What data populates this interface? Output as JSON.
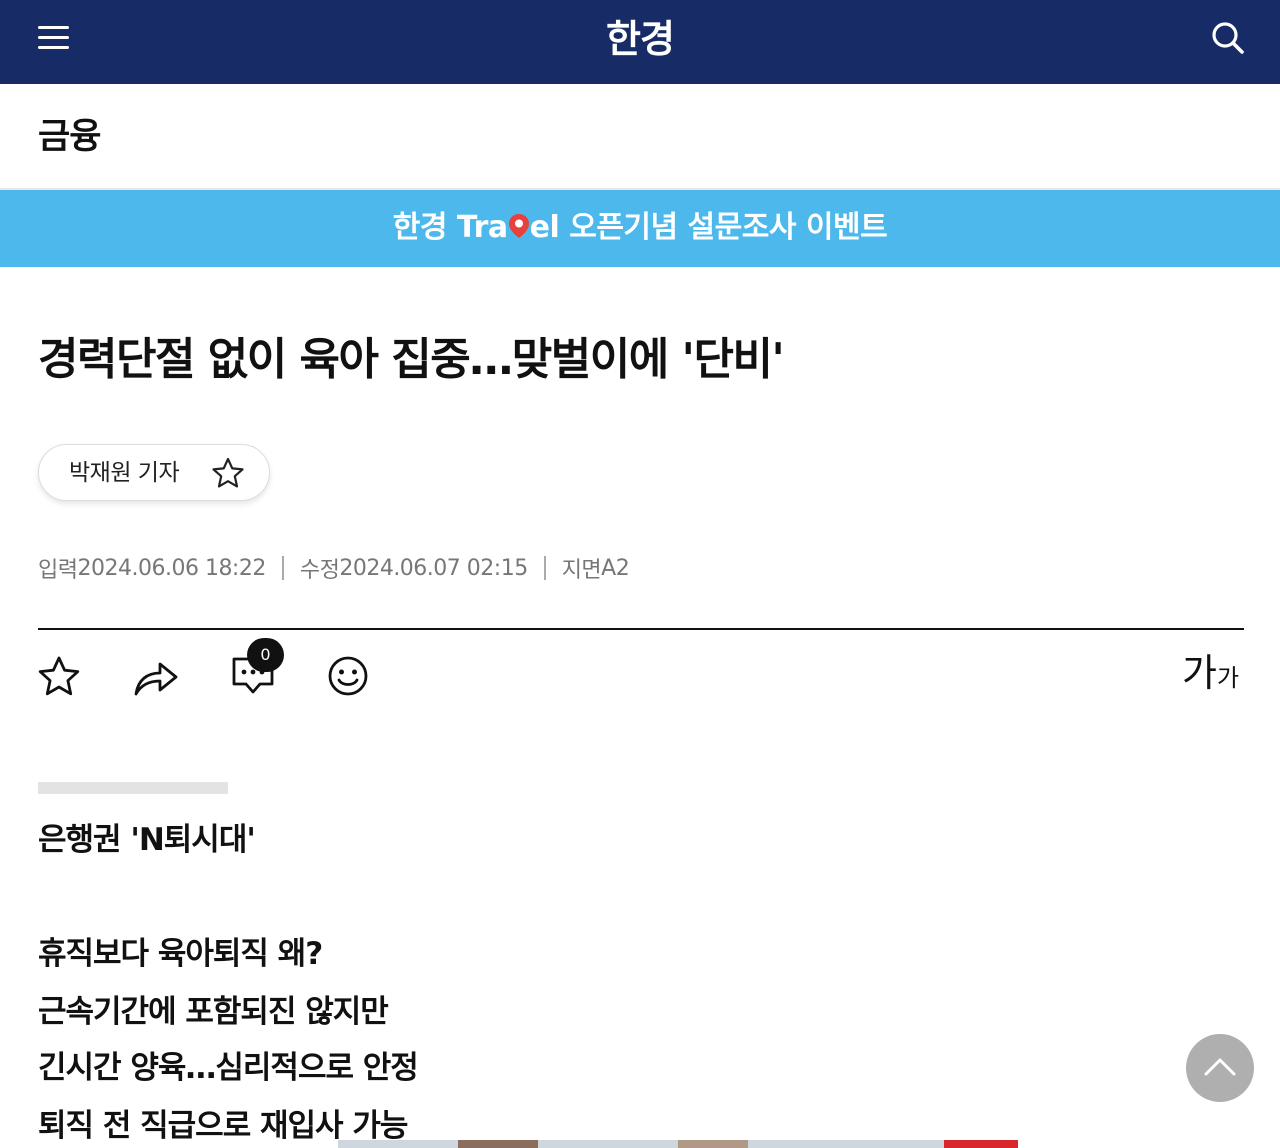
{
  "header": {
    "logo": "한경",
    "menu_icon": "hamburger-menu-icon",
    "search_icon": "search-icon",
    "background": "#172b66"
  },
  "section": {
    "title": "금융"
  },
  "banner": {
    "text_before": "한경 Tra",
    "text_after": "el 오픈기념 설문조사 이벤트",
    "pin_icon": "location-pin-icon",
    "background": "#4db8ec"
  },
  "article": {
    "headline": "경력단절 없이 육아 집중…맞벌이에 '단비'",
    "reporter": {
      "name": "박재원 기자",
      "follow_icon": "star-outline-icon"
    },
    "dates": {
      "input_label": "입력",
      "input_value": "2024.06.06 18:22",
      "modified_label": "수정",
      "modified_value": "2024.06.07 02:15",
      "page_label": "지면",
      "page_value": "A2"
    },
    "toolbar": {
      "bookmark_icon": "star-outline-icon",
      "share_icon": "share-arrow-icon",
      "comment_icon": "comment-icon",
      "comment_count": "0",
      "emotion_icon": "smile-icon",
      "font_size_big": "가",
      "font_size_small": "가"
    },
    "subheadings": [
      "은행권 'N퇴시대'",
      "휴직보다 육아퇴직 왜?",
      "근속기간에 포함되진 않지만",
      "긴시간 양육…심리적으로 안정",
      "퇴직 전 직급으로 재입사 가능"
    ]
  },
  "scroll_top": {
    "icon": "chevron-up-icon"
  }
}
